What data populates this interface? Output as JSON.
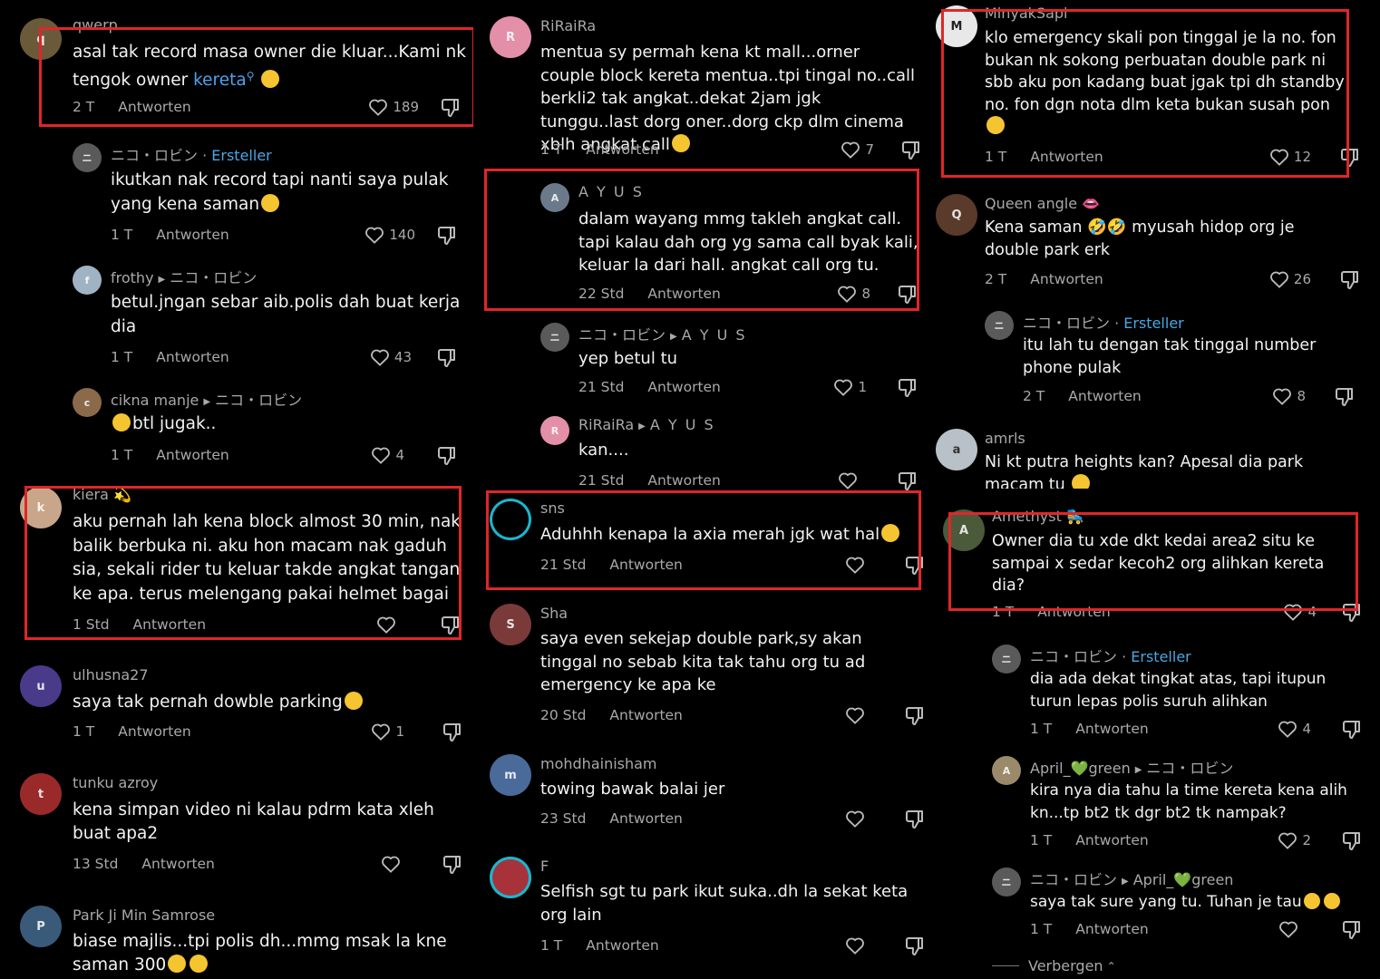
{
  "labels": {
    "reply": "Antworten",
    "creator": "Ersteller",
    "hide": "Verbergen"
  },
  "col1": [
    {
      "user": "qwerp",
      "text": "asal tak record masa owner die kluar...Kami nk tengok owner",
      "link": "kereta",
      "emoji": "😂",
      "time": "2 T",
      "likes": "189"
    },
    {
      "user": "ニコ・ロビン",
      "text": "ikutkan nak record tapi nanti saya pulak yang kena saman",
      "emoji": "😅",
      "time": "1 T",
      "likes": "140"
    },
    {
      "user": "frothy",
      "target": "ニコ・ロビン",
      "text": "betul.jngan sebar aib.polis dah buat kerja dia",
      "time": "1 T",
      "likes": "43"
    },
    {
      "user": "cikna manje",
      "target": "ニコ・ロビン",
      "text": "btl jugak..",
      "emoji": "😅",
      "time": "1 T",
      "likes": "4"
    },
    {
      "user": "kiera 💫",
      "text": "aku pernah lah kena block almost 30 min, nak balik berbuka ni. aku hon macam nak gaduh sia, sekali rider tu keluar takde angkat tangan ke apa. terus melengang pakai helmet bagai",
      "time": "1 Std",
      "likes": ""
    },
    {
      "user": "ulhusna27",
      "text": "saya tak pernah dowble parking",
      "emoji": "🙃",
      "time": "1 T",
      "likes": "1"
    },
    {
      "user": "tunku azroy",
      "text": "kena simpan video ni kalau pdrm kata xleh buat apa2",
      "time": "13 Std",
      "likes": ""
    },
    {
      "user": "Park Ji Min Samrose",
      "text": "biase majlis...tpi polis dh...mmg msak la kne saman 300",
      "emoji": "😂😂",
      "time": "",
      "likes": ""
    }
  ],
  "col2": [
    {
      "user": "RiRaiRa",
      "text": "mentua sy permah kena kt mall...orner couple block kereta mentua..tpi tingal no..call berkli2 tak angkat..dekat 2jam jgk tunggu..last dorg oner..dorg ckp dlm cinema xblh angkat call",
      "emoji": "😳",
      "time": "1 T",
      "likes": "7"
    },
    {
      "user": "A Y U S",
      "text": "dalam wayang mmg takleh angkat call. tapi kalau dah org yg sama call byak kali, keluar la dari hall. angkat call org tu.",
      "time": "22 Std",
      "likes": "8"
    },
    {
      "user": "ニコ・ロビン",
      "target": "A Y U S",
      "text": "yep betul tu",
      "time": "21 Std",
      "likes": "1"
    },
    {
      "user": "RiRaiRa",
      "target": "A Y U S",
      "text": "kan....",
      "time": "21 Std",
      "likes": ""
    },
    {
      "user": "sns",
      "text": "Aduhhh kenapa la axia merah jgk wat hal",
      "emoji": "😆",
      "time": "21 Std",
      "likes": ""
    },
    {
      "user": "Sha",
      "text": "saya even sekejap double park,sy akan tinggal no sebab kita tak tahu org tu ad emergency ke apa ke",
      "time": "20 Std",
      "likes": ""
    },
    {
      "user": "mohdhainisham",
      "text": "towing bawak balai jer",
      "time": "23 Std",
      "likes": ""
    },
    {
      "user": "F",
      "text": "Selfish sgt tu park ikut suka..dh la sekat keta org lain",
      "time": "1 T",
      "likes": ""
    }
  ],
  "col3": [
    {
      "user": "MinyakSapi",
      "text": "klo emergency skali pon tinggal je la no. fon bukan nk sokong perbuatan double park ni sbb aku pon kadang buat jgak tpi dh standby no. fon dgn nota dlm keta bukan susah pon",
      "emoji": "😭",
      "time": "1 T",
      "likes": "12"
    },
    {
      "user": "Queen angle 👄",
      "text": "Kena saman 🤣🤣 myusah hidop org je double park erk",
      "time": "2 T",
      "likes": "26"
    },
    {
      "user": "ニコ・ロビン",
      "text": "itu lah tu dengan tak tinggal number phone pulak",
      "time": "2 T",
      "likes": "8"
    },
    {
      "user": "amrls",
      "text": "Ni kt putra heights kan? Apesal dia park macam tu",
      "emoji": "😅",
      "time": "",
      "likes": ""
    },
    {
      "user": "Amethyst 🛼",
      "text": "Owner dia tu xde dkt kedai area2 situ ke sampai x sedar kecoh2 org alihkan kereta dia?",
      "time": "1 T",
      "likes": "4"
    },
    {
      "user": "ニコ・ロビン",
      "text": "dia ada dekat tingkat atas, tapi itupun turun lepas polis suruh alihkan",
      "time": "1 T",
      "likes": "4"
    },
    {
      "user": "April_💚green",
      "target": "ニコ・ロビン",
      "text": "kira nya dia tahu la time kereta kena alih kn...tp bt2 tk dgr bt2 tk nampak?",
      "time": "1 T",
      "likes": "2"
    },
    {
      "user": "ニコ・ロビン",
      "target": "April_💚green",
      "text": "saya tak sure yang tu. Tuhan je tau",
      "emoji": "😅😂",
      "time": "1 T",
      "likes": ""
    }
  ],
  "colors": {
    "highlight": "#e0262a",
    "creator": "#49a7e4",
    "link": "#4da3ee",
    "muted": "#a9a9a9"
  }
}
